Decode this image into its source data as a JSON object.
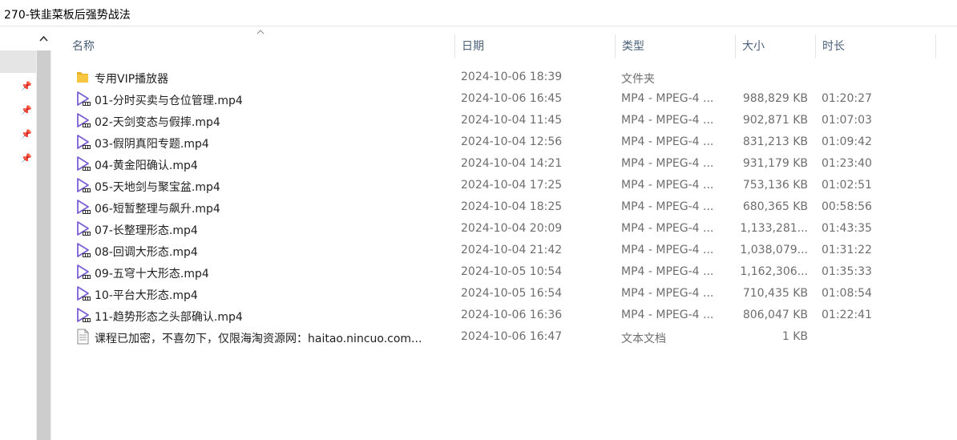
{
  "window": {
    "title": "270-铁韭菜板后强势战法"
  },
  "columns": {
    "name": "名称",
    "date": "日期",
    "type": "类型",
    "size": "大小",
    "duration": "时长"
  },
  "files": [
    {
      "icon": "folder",
      "name": "专用VIP播放器",
      "date": "2024-10-06 18:39",
      "type": "文件夹",
      "size": "",
      "duration": ""
    },
    {
      "icon": "video",
      "name": "01-分时买卖与仓位管理.mp4",
      "date": "2024-10-06 16:45",
      "type": "MP4 - MPEG-4 ...",
      "size": "988,829 KB",
      "duration": "01:20:27"
    },
    {
      "icon": "video",
      "name": "02-天剑变态与假摔.mp4",
      "date": "2024-10-04 11:45",
      "type": "MP4 - MPEG-4 ...",
      "size": "902,871 KB",
      "duration": "01:07:03"
    },
    {
      "icon": "video",
      "name": "03-假阴真阳专题.mp4",
      "date": "2024-10-04 12:56",
      "type": "MP4 - MPEG-4 ...",
      "size": "831,213 KB",
      "duration": "01:09:42"
    },
    {
      "icon": "video",
      "name": "04-黄金阳确认.mp4",
      "date": "2024-10-04 14:21",
      "type": "MP4 - MPEG-4 ...",
      "size": "931,179 KB",
      "duration": "01:23:40"
    },
    {
      "icon": "video",
      "name": "05-天地剑与聚宝盆.mp4",
      "date": "2024-10-04 17:25",
      "type": "MP4 - MPEG-4 ...",
      "size": "753,136 KB",
      "duration": "01:02:51"
    },
    {
      "icon": "video",
      "name": "06-短暂整理与飙升.mp4",
      "date": "2024-10-04 18:25",
      "type": "MP4 - MPEG-4 ...",
      "size": "680,365 KB",
      "duration": "00:58:56"
    },
    {
      "icon": "video",
      "name": "07-长整理形态.mp4",
      "date": "2024-10-04 20:09",
      "type": "MP4 - MPEG-4 ...",
      "size": "1,133,281...",
      "duration": "01:43:35"
    },
    {
      "icon": "video",
      "name": "08-回调大形态.mp4",
      "date": "2024-10-04 21:42",
      "type": "MP4 - MPEG-4 ...",
      "size": "1,038,079...",
      "duration": "01:31:22"
    },
    {
      "icon": "video",
      "name": "09-五穹十大形态.mp4",
      "date": "2024-10-05 10:54",
      "type": "MP4 - MPEG-4 ...",
      "size": "1,162,306...",
      "duration": "01:35:33"
    },
    {
      "icon": "video",
      "name": "10-平台大形态.mp4",
      "date": "2024-10-05 16:54",
      "type": "MP4 - MPEG-4 ...",
      "size": "710,435 KB",
      "duration": "01:08:54"
    },
    {
      "icon": "video",
      "name": "11-趋势形态之头部确认.mp4",
      "date": "2024-10-06 16:36",
      "type": "MP4 - MPEG-4 ...",
      "size": "806,047 KB",
      "duration": "01:22:41"
    },
    {
      "icon": "text",
      "name": "课程已加密，不喜勿下，仅限海淘资源网：haitao.nincuo.com...",
      "date": "2024-10-06 16:47",
      "type": "文本文档",
      "size": "1 KB",
      "duration": ""
    }
  ],
  "colors": {
    "folder": "#f7c640",
    "video_icon": "#7b5fd6",
    "header_text": "#4c607a"
  }
}
